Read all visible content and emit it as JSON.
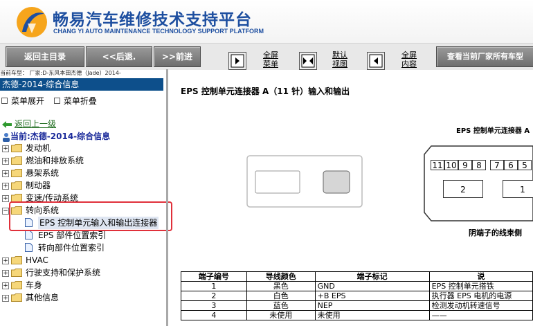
{
  "header": {
    "title": "畅易汽车维修技术支持平台",
    "subtitle": "CHANG YI AUTO MAINTENANCE TECHNOLOGY SUPPORT PLATFORM",
    "brand_color": "#1e4fa0"
  },
  "toolbar": {
    "back_home": "返回主目录",
    "back": "<<后退.",
    "forward": ">>前进",
    "fullscreen_menu": [
      "全屏",
      "菜单"
    ],
    "default_view": [
      "默认",
      "视图"
    ],
    "fullscreen_content": [
      "全屏",
      "内容"
    ],
    "view_all_models": "查看当前厂家所有车型"
  },
  "vehicle_line": "当前车型：   厂家:D-东风本田杰德（Jade）2014-",
  "sidebar": {
    "title": "杰德-2014-综合信息",
    "expand": "菜单展开",
    "collapse": "菜单折叠",
    "back_up": "返回上一级",
    "current": "当前:杰德-2014-综合信息",
    "items": [
      {
        "label": "发动机",
        "kind": "folder",
        "expanded": false
      },
      {
        "label": "燃油和排放系统",
        "kind": "folder",
        "expanded": false
      },
      {
        "label": "悬架系统",
        "kind": "folder",
        "expanded": false
      },
      {
        "label": "制动器",
        "kind": "folder",
        "expanded": false
      },
      {
        "label": "变速/传动系统",
        "kind": "folder",
        "expanded": false
      },
      {
        "label": "转向系统",
        "kind": "folder",
        "expanded": true
      },
      {
        "label": "EPS 控制单元输入和输出连接器",
        "kind": "doc",
        "selected": true
      },
      {
        "label": "EPS 部件位置索引",
        "kind": "doc"
      },
      {
        "label": "转向部件位置索引",
        "kind": "doc"
      },
      {
        "label": "HVAC",
        "kind": "folder",
        "expanded": false
      },
      {
        "label": "行驶支持和保护系统",
        "kind": "folder",
        "expanded": false
      },
      {
        "label": "车身",
        "kind": "folder",
        "expanded": false
      },
      {
        "label": "其他信息",
        "kind": "folder",
        "expanded": false
      }
    ]
  },
  "main": {
    "title": "EPS 控制单元连接器 A（11 针）输入和输出",
    "connector_label": "EPS 控制单元连接器 A",
    "connector_caption": "阴端子的线束侧",
    "small_pins": [
      "11",
      "10",
      "9",
      "8",
      "7",
      "6",
      "5"
    ],
    "big_pins": [
      "2",
      "1"
    ],
    "table": {
      "headers": [
        "端子编号",
        "导线颜色",
        "端子标记",
        "说"
      ],
      "rows": [
        [
          "1",
          "黑色",
          "GND",
          "EPS 控制单元搭铁"
        ],
        [
          "2",
          "白色",
          "+B EPS",
          "执行器 EPS 电机的电源"
        ],
        [
          "3",
          "蓝色",
          "NEP",
          "检测发动机转速信号"
        ],
        [
          "4",
          "未使用",
          "未使用",
          "——"
        ]
      ]
    }
  },
  "colors": {
    "sidebar_title_bg": "#0d4f8b",
    "highlight": "#e0303a",
    "current_text": "#1a2a9a"
  }
}
